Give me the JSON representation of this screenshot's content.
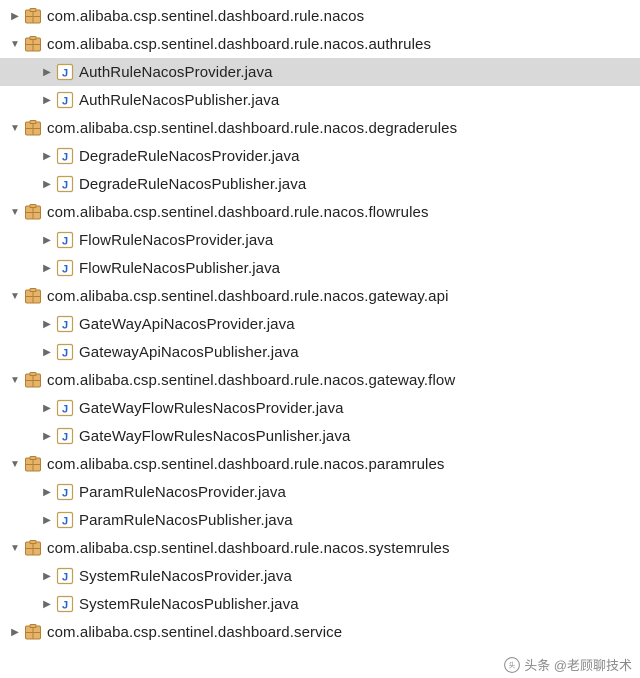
{
  "tree": [
    {
      "depth": 0,
      "arrow": "right",
      "icon": "package",
      "label": "com.alibaba.csp.sentinel.dashboard.rule.nacos",
      "interactable": true,
      "selected": false
    },
    {
      "depth": 0,
      "arrow": "down",
      "icon": "package",
      "label": "com.alibaba.csp.sentinel.dashboard.rule.nacos.authrules",
      "interactable": true,
      "selected": false
    },
    {
      "depth": 1,
      "arrow": "right",
      "icon": "java",
      "label": "AuthRuleNacosProvider.java",
      "interactable": true,
      "selected": true
    },
    {
      "depth": 1,
      "arrow": "right",
      "icon": "java",
      "label": "AuthRuleNacosPublisher.java",
      "interactable": true,
      "selected": false
    },
    {
      "depth": 0,
      "arrow": "down",
      "icon": "package",
      "label": "com.alibaba.csp.sentinel.dashboard.rule.nacos.degraderules",
      "interactable": true,
      "selected": false
    },
    {
      "depth": 1,
      "arrow": "right",
      "icon": "java",
      "label": "DegradeRuleNacosProvider.java",
      "interactable": true,
      "selected": false
    },
    {
      "depth": 1,
      "arrow": "right",
      "icon": "java",
      "label": "DegradeRuleNacosPublisher.java",
      "interactable": true,
      "selected": false
    },
    {
      "depth": 0,
      "arrow": "down",
      "icon": "package",
      "label": "com.alibaba.csp.sentinel.dashboard.rule.nacos.flowrules",
      "interactable": true,
      "selected": false
    },
    {
      "depth": 1,
      "arrow": "right",
      "icon": "java",
      "label": "FlowRuleNacosProvider.java",
      "interactable": true,
      "selected": false
    },
    {
      "depth": 1,
      "arrow": "right",
      "icon": "java",
      "label": "FlowRuleNacosPublisher.java",
      "interactable": true,
      "selected": false
    },
    {
      "depth": 0,
      "arrow": "down",
      "icon": "package",
      "label": "com.alibaba.csp.sentinel.dashboard.rule.nacos.gateway.api",
      "interactable": true,
      "selected": false
    },
    {
      "depth": 1,
      "arrow": "right",
      "icon": "java",
      "label": "GateWayApiNacosProvider.java",
      "interactable": true,
      "selected": false
    },
    {
      "depth": 1,
      "arrow": "right",
      "icon": "java",
      "label": "GatewayApiNacosPublisher.java",
      "interactable": true,
      "selected": false
    },
    {
      "depth": 0,
      "arrow": "down",
      "icon": "package",
      "label": "com.alibaba.csp.sentinel.dashboard.rule.nacos.gateway.flow",
      "interactable": true,
      "selected": false
    },
    {
      "depth": 1,
      "arrow": "right",
      "icon": "java",
      "label": "GateWayFlowRulesNacosProvider.java",
      "interactable": true,
      "selected": false
    },
    {
      "depth": 1,
      "arrow": "right",
      "icon": "java",
      "label": "GateWayFlowRulesNacosPunlisher.java",
      "interactable": true,
      "selected": false
    },
    {
      "depth": 0,
      "arrow": "down",
      "icon": "package",
      "label": "com.alibaba.csp.sentinel.dashboard.rule.nacos.paramrules",
      "interactable": true,
      "selected": false
    },
    {
      "depth": 1,
      "arrow": "right",
      "icon": "java",
      "label": "ParamRuleNacosProvider.java",
      "interactable": true,
      "selected": false
    },
    {
      "depth": 1,
      "arrow": "right",
      "icon": "java",
      "label": "ParamRuleNacosPublisher.java",
      "interactable": true,
      "selected": false
    },
    {
      "depth": 0,
      "arrow": "down",
      "icon": "package",
      "label": "com.alibaba.csp.sentinel.dashboard.rule.nacos.systemrules",
      "interactable": true,
      "selected": false
    },
    {
      "depth": 1,
      "arrow": "right",
      "icon": "java",
      "label": "SystemRuleNacosProvider.java",
      "interactable": true,
      "selected": false
    },
    {
      "depth": 1,
      "arrow": "right",
      "icon": "java",
      "label": "SystemRuleNacosPublisher.java",
      "interactable": true,
      "selected": false
    },
    {
      "depth": 0,
      "arrow": "right",
      "icon": "package",
      "label": "com.alibaba.csp.sentinel.dashboard.service",
      "interactable": true,
      "selected": false
    }
  ],
  "credit": "头条 @老顾聊技术",
  "icons": {
    "arrow_right": "▶",
    "arrow_down": "▼"
  }
}
